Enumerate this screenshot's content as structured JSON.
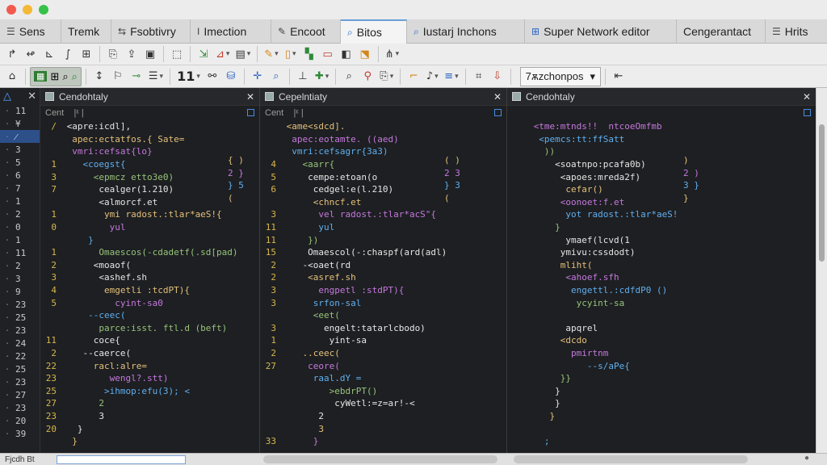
{
  "window": {
    "traffic_lights": [
      "close",
      "minimize",
      "zoom"
    ]
  },
  "tabs": [
    {
      "label": "Sens",
      "icon": "list-icon",
      "glyph": "☰"
    },
    {
      "label": "Tremk",
      "icon": "",
      "glyph": ""
    },
    {
      "label": "Fsobtivry",
      "icon": "tool-icon",
      "glyph": "⇆"
    },
    {
      "label": "Imection",
      "icon": "cursor-icon",
      "glyph": "I"
    },
    {
      "label": "Encoot",
      "icon": "edit-icon",
      "glyph": "✎"
    },
    {
      "label": "Bitos",
      "icon": "find-icon",
      "glyph": "⌕",
      "active": true
    },
    {
      "label": "Iustarj Inchons",
      "icon": "search-icon",
      "glyph": "⌕"
    },
    {
      "label": "Super Network editor",
      "icon": "network-icon",
      "glyph": "⊞"
    },
    {
      "label": "Cengerantact",
      "icon": "",
      "glyph": ""
    },
    {
      "label": "Hrits",
      "icon": "list-icon",
      "glyph": "☰"
    }
  ],
  "toolbar2": {
    "counter": "11",
    "select_value": "7ѫzchonpos"
  },
  "panes": [
    {
      "title": "Cendohtaly",
      "sub_label": "Cent",
      "sub_extra": "|ᵋ |",
      "lines": [
        {
          "n": "/",
          "t": " <apre:icdl],"
        },
        {
          "n": "",
          "t": "  apec:ectatfos.{ Sate="
        },
        {
          "n": "",
          "t": "  vmri:cefsat{lo}"
        },
        {
          "n": "1",
          "t": "    <coegst{"
        },
        {
          "n": "3",
          "t": "      <epmcz etto3e0)"
        },
        {
          "n": "7",
          "t": "       cealger(1.210)"
        },
        {
          "n": "",
          "t": "       <almorcf.et"
        },
        {
          "n": "1",
          "t": "        ymi radost.:tlar*aeS!{"
        },
        {
          "n": "0",
          "t": "         yul"
        },
        {
          "n": "",
          "t": "     }"
        },
        {
          "n": "1",
          "t": "       Omaescos(-cdadetf(.sd[pad)"
        },
        {
          "n": "2",
          "t": "      <moaof("
        },
        {
          "n": "3",
          "t": "       <ashef.sh"
        },
        {
          "n": "4",
          "t": "        emgetli :tcdPT){"
        },
        {
          "n": "5",
          "t": "          cyint-sa0"
        },
        {
          "n": "",
          "t": "     --ceec("
        },
        {
          "n": "",
          "t": "       parce:isst. ftl.d (beft)"
        },
        {
          "n": "11",
          "t": "      coce{"
        },
        {
          "n": "2",
          "t": "    --caerce("
        },
        {
          "n": "22",
          "t": "      racl:alre="
        },
        {
          "n": "23",
          "t": "         wengl?.stt)"
        },
        {
          "n": "25",
          "t": "        >ihmop:efu(3); <"
        },
        {
          "n": "27",
          "t": "       2"
        },
        {
          "n": "23",
          "t": "       3"
        },
        {
          "n": "20",
          "t": "   }"
        },
        {
          "n": "",
          "t": "  }"
        }
      ]
    },
    {
      "title": "Cepelntiaty",
      "sub_label": "Cent",
      "sub_extra": "|ᵋ |",
      "lines": [
        {
          "n": "",
          "t": " <ame<sdcd]."
        },
        {
          "n": "",
          "t": "  apec:eotamte. ((aed)"
        },
        {
          "n": "",
          "t": "  vmri:cefsagrr{3a3)"
        },
        {
          "n": "4",
          "t": "    <aarr{"
        },
        {
          "n": "5",
          "t": "     cempe:etoan(o"
        },
        {
          "n": "6",
          "t": "      cedgel:e(l.210)"
        },
        {
          "n": "",
          "t": "      <chncf.et"
        },
        {
          "n": "3",
          "t": "       vel radost.:tlar*acS\"{"
        },
        {
          "n": "11",
          "t": "       yul"
        },
        {
          "n": "11",
          "t": "     })"
        },
        {
          "n": "15",
          "t": "     Omaescol(-:chaspf(ard(adl)"
        },
        {
          "n": "2",
          "t": "    -<oaet(rd"
        },
        {
          "n": "2",
          "t": "     <asref.sh"
        },
        {
          "n": "3",
          "t": "       engpetl :stdPT){"
        },
        {
          "n": "3",
          "t": "      srfon-sal"
        },
        {
          "n": "",
          "t": "      <eet("
        },
        {
          "n": "3",
          "t": "        engelt:tatarlcbodo)"
        },
        {
          "n": "1",
          "t": "         yint-sa"
        },
        {
          "n": "2",
          "t": "    ..ceec("
        },
        {
          "n": "27",
          "t": "     ceore("
        },
        {
          "n": "",
          "t": "      raal.dY ="
        },
        {
          "n": "",
          "t": "         >ebdrPT()"
        },
        {
          "n": "",
          "t": "          cyWetl:=z=ar!-<"
        },
        {
          "n": "",
          "t": "       2"
        },
        {
          "n": "",
          "t": "       3"
        },
        {
          "n": "33",
          "t": "      }"
        }
      ]
    },
    {
      "title": "Cendohtaly",
      "sub_label": "",
      "sub_extra": "",
      "lines": [
        {
          "n": "",
          "t": " <tme:mtnds!!  ntcoeOmfmb"
        },
        {
          "n": "",
          "t": "  <pemcs:tt:ffSatt"
        },
        {
          "n": "",
          "t": "   ))"
        },
        {
          "n": "",
          "t": "     <soatnpo:pcafa0b)"
        },
        {
          "n": "",
          "t": "      <apoes:mreda2f)"
        },
        {
          "n": "",
          "t": "       cefar()"
        },
        {
          "n": "",
          "t": "      <oonoet:f.et"
        },
        {
          "n": "",
          "t": "       yot radost.:tlar*aeS!"
        },
        {
          "n": "",
          "t": "     }"
        },
        {
          "n": "",
          "t": "       ymaef(lcvd(1"
        },
        {
          "n": "",
          "t": "      ymivu:cssdodt)"
        },
        {
          "n": "",
          "t": "      mliht("
        },
        {
          "n": "",
          "t": "       <ahoef.sfh"
        },
        {
          "n": "",
          "t": "        engettl.:cdfdP0 ()"
        },
        {
          "n": "",
          "t": "         ycyint-sa"
        },
        {
          "n": "",
          "t": ""
        },
        {
          "n": "",
          "t": "       apqrel"
        },
        {
          "n": "",
          "t": "      <dcdo"
        },
        {
          "n": "",
          "t": "        pmirtnm"
        },
        {
          "n": "",
          "t": "           --s/aPe{"
        },
        {
          "n": "",
          "t": "      }}"
        },
        {
          "n": "",
          "t": "     }"
        },
        {
          "n": "",
          "t": "     }"
        },
        {
          "n": "",
          "t": "    }"
        },
        {
          "n": "",
          "t": ""
        },
        {
          "n": "",
          "t": "   ;"
        }
      ]
    }
  ],
  "gutter": {
    "rows": [
      "11",
      "¥",
      "⁄",
      "3",
      "5",
      "6",
      "7",
      "1",
      "2",
      "0",
      "1",
      "11",
      "2",
      "3",
      "9",
      "23",
      "25",
      "23",
      "24",
      "22",
      "25",
      "23",
      "27",
      "23",
      "20",
      "39"
    ]
  },
  "status": {
    "label": "Fjcdh Bt"
  }
}
